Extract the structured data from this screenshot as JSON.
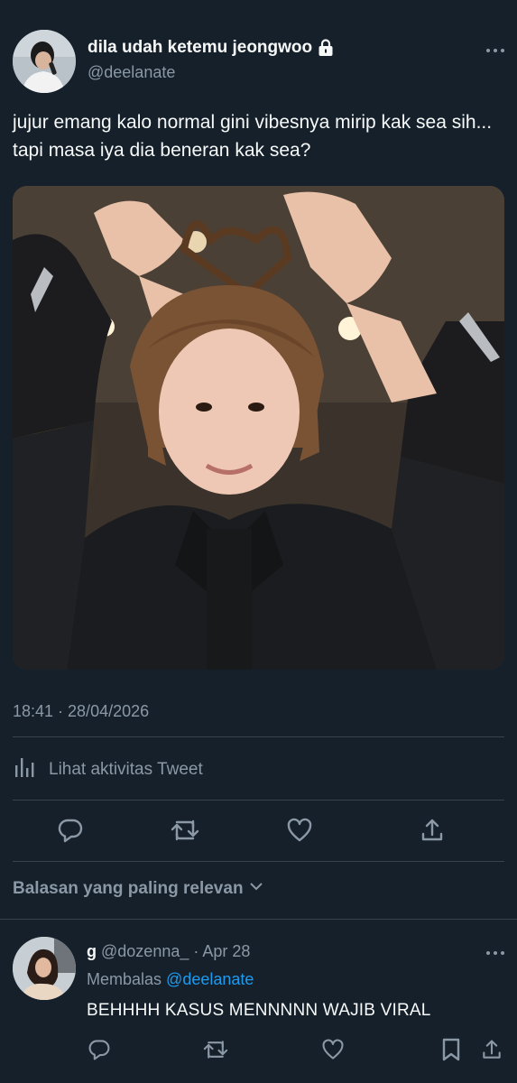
{
  "tweet": {
    "display_name": "dila udah ketemu jeongwoo",
    "handle": "@deelanate",
    "text": "jujur emang kalo normal gini vibesnya mirip kak sea sih... tapi masa iya dia beneran kak sea?",
    "timestamp": "18:41 · 28/04/2026",
    "activity_label": "Lihat aktivitas Tweet"
  },
  "replies_sort_label": "Balasan yang paling relevan",
  "reply": {
    "name": "g",
    "handle": "@dozenna_",
    "date": "· Apr 28",
    "replying_prefix": "Membalas",
    "replying_to": "@deelanate",
    "text": "BEHHHH KASUS MENNNNN WAJIB VIRAL"
  },
  "colors": {
    "background": "#15202b",
    "text_primary": "#f7f9f9",
    "text_secondary": "#8b98a5",
    "accent": "#1d9bf0",
    "divider": "#38444d"
  },
  "icons": [
    "lock-icon",
    "more-icon",
    "analytics-icon",
    "reply-icon",
    "retweet-icon",
    "like-icon",
    "share-icon",
    "bookmark-icon",
    "chevron-down-icon"
  ]
}
